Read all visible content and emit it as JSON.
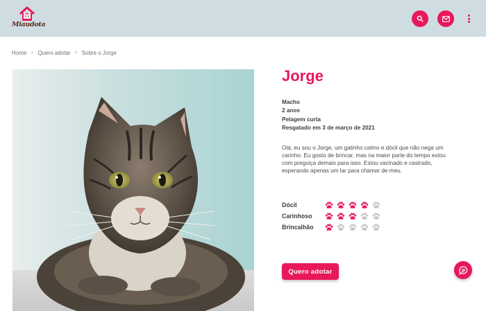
{
  "brand": {
    "name": "Miaudota",
    "accent": "#e8185b",
    "header_bg": "#cfdde2"
  },
  "header": {
    "icons": [
      "search-icon",
      "mail-icon",
      "more-vertical-icon"
    ]
  },
  "breadcrumb": [
    "Home",
    "Quero adotar",
    "Sobre o Jorge"
  ],
  "pet": {
    "name": "Jorge",
    "facts": [
      "Macho",
      "2 anos",
      "Pelagem curta",
      "Resgatado em 3 de março de 2021"
    ],
    "description": "Olá, eu sou o Jorge, um gatinho calmo e dócil que não nega um carinho. Eu gosto de brincar, mas na maior parte do tempo estou com preguiça demais para isso. Estou vacinado e castrado, esperando apenas um lar para chamar de meu.",
    "traits": [
      {
        "label": "Dócil",
        "rating": 4,
        "max": 5
      },
      {
        "label": "Carinhoso",
        "rating": 3,
        "max": 5
      },
      {
        "label": "Brincalhão",
        "rating": 1,
        "max": 5
      }
    ]
  },
  "actions": {
    "adopt_label": "Quero adotar",
    "chat_icon": "chat-icon"
  }
}
